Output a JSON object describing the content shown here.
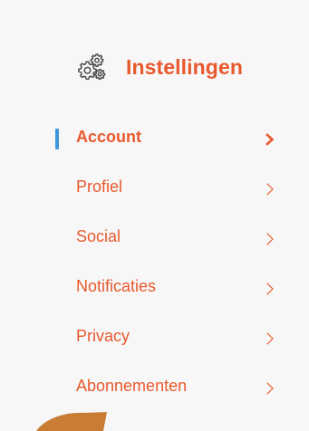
{
  "header": {
    "title": "Instellingen",
    "icon": "gears-icon"
  },
  "menu": {
    "items": [
      {
        "label": "Account",
        "active": true,
        "icon": "chevron-right-icon"
      },
      {
        "label": "Profiel",
        "active": false,
        "icon": "chevron-right-icon"
      },
      {
        "label": "Social",
        "active": false,
        "icon": "chevron-right-icon"
      },
      {
        "label": "Notificaties",
        "active": false,
        "icon": "chevron-right-icon"
      },
      {
        "label": "Privacy",
        "active": false,
        "icon": "chevron-right-icon"
      },
      {
        "label": "Abonnementen",
        "active": false,
        "icon": "chevron-right-icon"
      }
    ]
  },
  "colors": {
    "accent": "#e8592d",
    "active_indicator": "#3f97d9",
    "background": "#f7f7f7",
    "decoration": "#c87c34"
  }
}
